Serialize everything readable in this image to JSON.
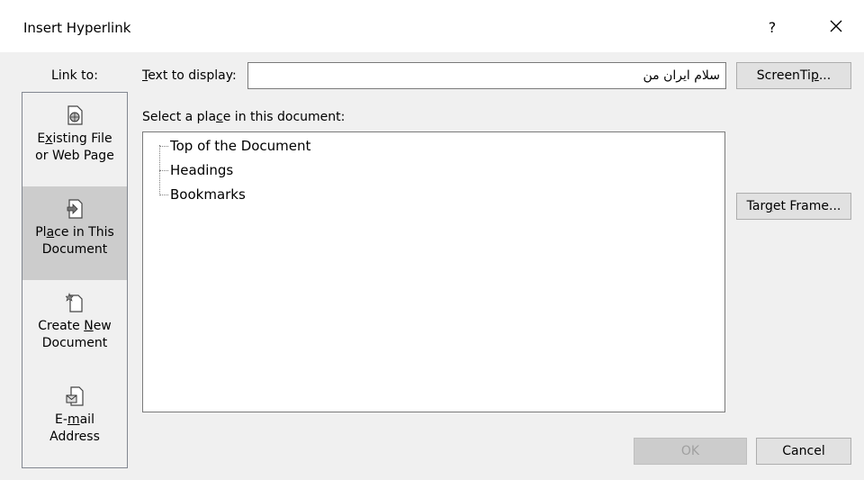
{
  "dialog": {
    "title": "Insert Hyperlink",
    "help_label": "?",
    "close_icon": "close-icon"
  },
  "link_to": {
    "label": "Link to:",
    "items": [
      {
        "line1_pre": "E",
        "line1_u": "x",
        "line1_post": "isting File",
        "line2": "or Web Page",
        "icon": "globe-file-icon"
      },
      {
        "line1_pre": "Pl",
        "line1_u": "a",
        "line1_post": "ce in This",
        "line2": "Document",
        "icon": "document-place-icon",
        "selected": true
      },
      {
        "line1_pre": "Create ",
        "line1_u": "N",
        "line1_post": "ew",
        "line2": "Document",
        "icon": "new-document-icon"
      },
      {
        "line1_pre": "E-",
        "line1_u": "m",
        "line1_post": "ail",
        "line2": "Address",
        "icon": "email-icon"
      }
    ]
  },
  "text_to_display": {
    "label_u": "T",
    "label_rest": "ext to display:",
    "value": "سلام ایران من"
  },
  "place": {
    "label_pre": "Select a pla",
    "label_u": "c",
    "label_post": "e in this document:",
    "tree_items": [
      "Top of the Document",
      "Headings",
      "Bookmarks"
    ]
  },
  "buttons": {
    "screentip_pre": "ScreenTi",
    "screentip_u": "p",
    "screentip_post": "...",
    "target_pre": "Tar",
    "target_u": "g",
    "target_post": "et Frame...",
    "ok": "OK",
    "cancel": "Cancel"
  },
  "colors": {
    "selected_bg": "#cccccc",
    "dialog_bg": "#f0f0f0"
  }
}
